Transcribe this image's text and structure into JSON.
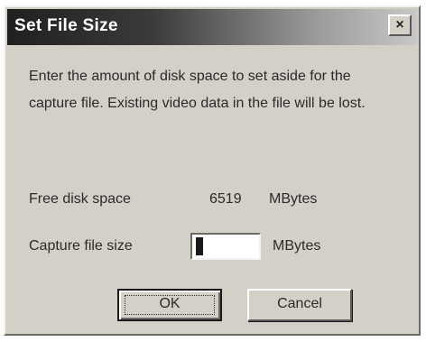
{
  "dialog": {
    "title": "Set File Size",
    "close_label": "×",
    "message": "Enter the amount of disk space to set aside for the capture file. Existing video data in the file will be lost.",
    "free_disk_label": "Free disk space",
    "free_disk_value": "6519",
    "free_disk_unit": "MBytes",
    "capture_size_label": "Capture file size",
    "capture_size_value": "",
    "capture_size_unit": "MBytes",
    "ok_label": "OK",
    "cancel_label": "Cancel"
  }
}
